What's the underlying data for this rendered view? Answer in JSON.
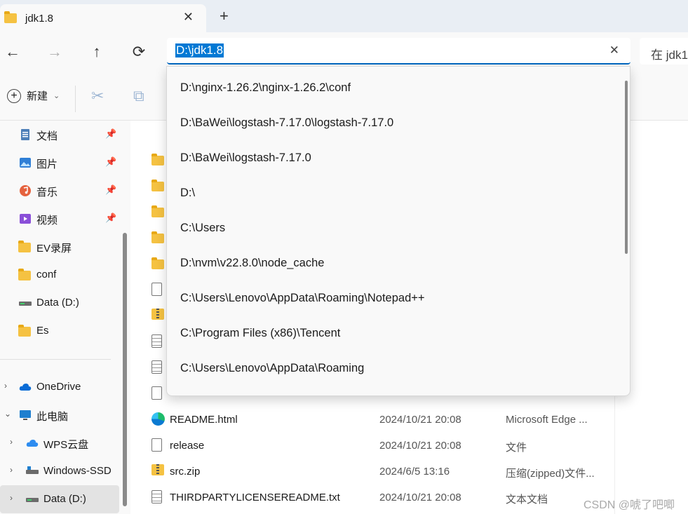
{
  "tab": {
    "title": "jdk1.8",
    "close": "✕",
    "new_tab": "+"
  },
  "nav": {
    "back": "←",
    "forward": "→",
    "up": "↑",
    "refresh": "⟳"
  },
  "address": {
    "value": "D:\\jdk1.8",
    "clear": "✕"
  },
  "search": {
    "placeholder": "在 jdk1"
  },
  "command_bar": {
    "new_label": "新建"
  },
  "sidebar": {
    "items": [
      {
        "label": "文档",
        "icon": "document-icon",
        "pinned": true
      },
      {
        "label": "图片",
        "icon": "pictures-icon",
        "pinned": true
      },
      {
        "label": "音乐",
        "icon": "music-icon",
        "pinned": true
      },
      {
        "label": "视频",
        "icon": "video-icon",
        "pinned": true
      },
      {
        "label": "EV录屏",
        "icon": "folder-icon",
        "pinned": false
      },
      {
        "label": "conf",
        "icon": "folder-icon",
        "pinned": false
      },
      {
        "label": "Data (D:)",
        "icon": "drive-icon",
        "pinned": false
      },
      {
        "label": "Es",
        "icon": "folder-icon",
        "pinned": false
      }
    ],
    "tree": [
      {
        "label": "OneDrive",
        "icon": "cloud-icon"
      },
      {
        "label": "此电脑",
        "icon": "pc-icon"
      },
      {
        "label": "WPS云盘",
        "icon": "cloud-icon"
      },
      {
        "label": "Windows-SSD",
        "icon": "drive-icon"
      },
      {
        "label": "Data (D:)",
        "icon": "drive-icon"
      }
    ]
  },
  "files": [
    {
      "name": "README.html",
      "date": "2024/10/21 20:08",
      "type": "Microsoft Edge ...",
      "icon": "edge-icon"
    },
    {
      "name": "release",
      "date": "2024/10/21 20:08",
      "type": "文件",
      "icon": "file-icon"
    },
    {
      "name": "src.zip",
      "date": "2024/6/5 13:16",
      "type": "压缩(zipped)文件...",
      "icon": "zip-icon"
    },
    {
      "name": "THIRDPARTYLICENSEREADME.txt",
      "date": "2024/10/21 20:08",
      "type": "文本文档",
      "icon": "text-file-icon"
    }
  ],
  "dropdown": {
    "items": [
      "D:\\nginx-1.26.2\\nginx-1.26.2\\conf",
      "D:\\BaWei\\logstash-7.17.0\\logstash-7.17.0",
      "D:\\BaWei\\logstash-7.17.0",
      "D:\\",
      "C:\\Users",
      "D:\\nvm\\v22.8.0\\node_cache",
      "C:\\Users\\Lenovo\\AppData\\Roaming\\Notepad++",
      "C:\\Program Files (x86)\\Tencent",
      "C:\\Users\\Lenovo\\AppData\\Roaming"
    ]
  },
  "watermark": "CSDN @唬了吧唧"
}
